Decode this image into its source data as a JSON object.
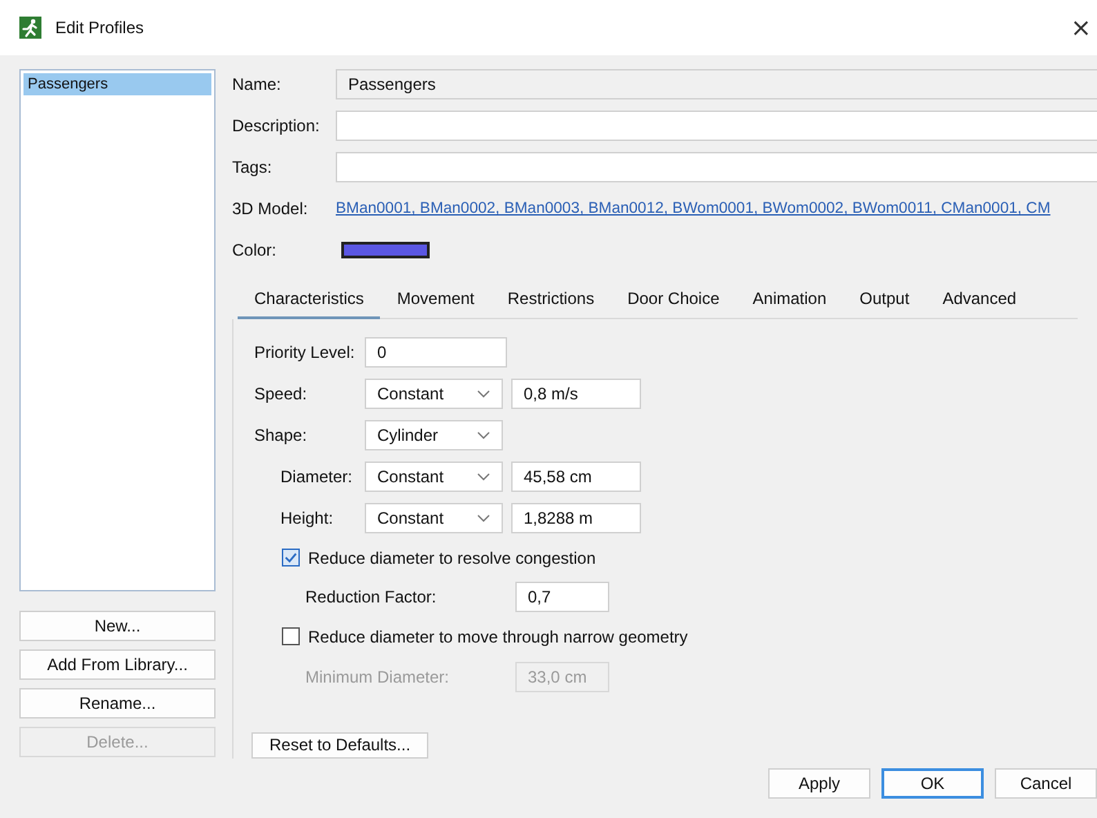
{
  "window": {
    "title": "Edit Profiles",
    "close": "×"
  },
  "profiles": [
    {
      "label": "Passengers",
      "selected": true
    }
  ],
  "list_buttons": [
    {
      "label": "New...",
      "disabled": false
    },
    {
      "label": "Add From Library...",
      "disabled": false
    },
    {
      "label": "Rename...",
      "disabled": false
    },
    {
      "label": "Delete...",
      "disabled": true
    }
  ],
  "form": {
    "name": {
      "label": "Name:",
      "value": "Passengers"
    },
    "description": {
      "label": "Description:"
    },
    "tags": {
      "label": "Tags:"
    },
    "model": {
      "label": "3D Model:",
      "value": "BMan0001, BMan0002, BMan0003, BMan0012, BWom0001, BWom0002, BWom0011, CMan0001, CM"
    },
    "color": {
      "label": "Color:",
      "color": "#5b57e3"
    }
  },
  "tabs": [
    {
      "label": "Characteristics",
      "selected": true
    },
    {
      "label": "Movement",
      "selected": false
    },
    {
      "label": "Restrictions",
      "selected": false
    },
    {
      "label": "Door Choice",
      "selected": false
    },
    {
      "label": "Animation",
      "selected": false
    },
    {
      "label": "Output",
      "selected": false
    },
    {
      "label": "Advanced",
      "selected": false
    }
  ],
  "rows": [
    {
      "kind": "field",
      "label": "Priority Level:",
      "value": "0"
    },
    {
      "kind": "select",
      "label": "Speed:",
      "option": "Constant",
      "value": "0,8 m/s"
    },
    {
      "kind": "select",
      "label": "Shape:",
      "option": "Cylinder",
      "children": [
        {
          "kind": "select",
          "label": "Diameter:",
          "option": "Constant",
          "value": "45,58 cm"
        },
        {
          "kind": "select",
          "label": "Height:",
          "option": "Constant",
          "value": "1,8288 m"
        }
      ]
    },
    {
      "kind": "checkbox",
      "label": "Reduce diameter to resolve congestion",
      "checked": true,
      "children": [
        {
          "kind": "field",
          "label": "Reduction Factor:",
          "value": "0,7",
          "disabled": false
        }
      ]
    },
    {
      "kind": "checkbox",
      "label": "Reduce diameter to move through narrow geometry",
      "checked": false,
      "children": [
        {
          "kind": "field",
          "label": "Minimum Diameter:",
          "value": "33,0 cm",
          "disabled": true
        }
      ]
    }
  ],
  "reset_button": "Reset to Defaults...",
  "dialog_buttons": [
    {
      "label": "Apply",
      "default": false
    },
    {
      "label": "OK",
      "default": true
    },
    {
      "label": "Cancel",
      "default": false
    }
  ]
}
